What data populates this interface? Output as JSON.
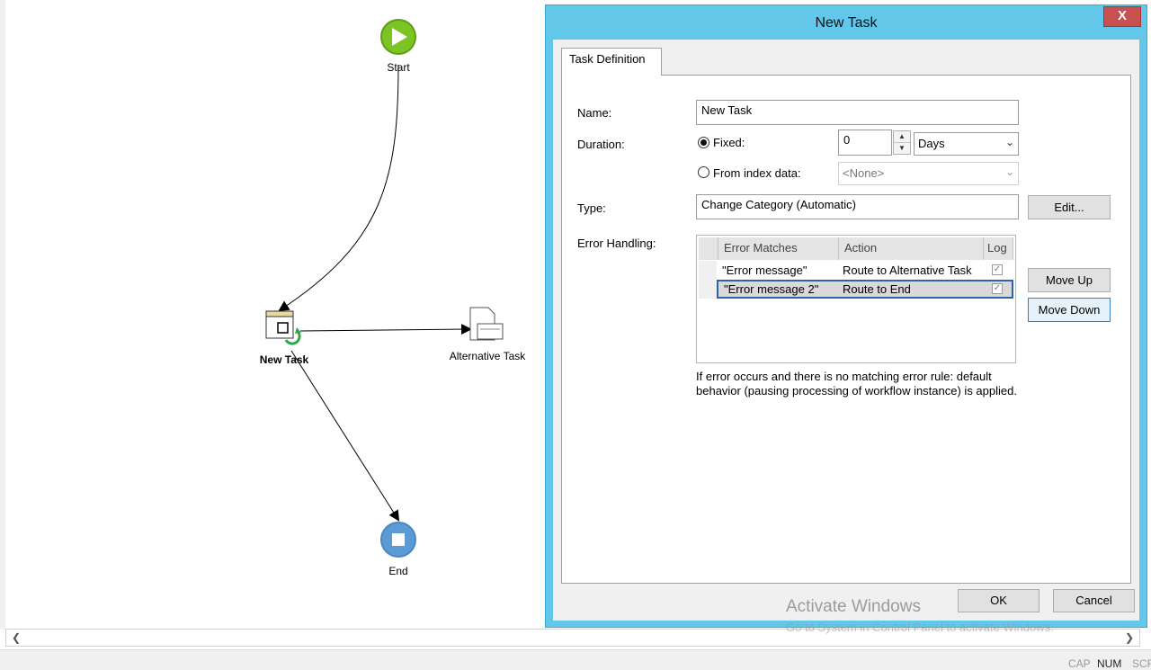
{
  "workflow": {
    "nodes": {
      "start": "Start",
      "new_task": "New Task",
      "alternative_task": "Alternative Task",
      "end": "End"
    }
  },
  "dialog": {
    "title": "New Task",
    "close_label": "X",
    "tab": "Task Definition",
    "name_label": "Name:",
    "name_value": "New Task",
    "duration_label": "Duration:",
    "fixed_label": "Fixed:",
    "fixed_value": "0",
    "unit_value": "Days",
    "from_index_label": "From index data:",
    "index_value": "<None>",
    "type_label": "Type:",
    "type_value": "Change Category (Automatic)",
    "edit_button": "Edit...",
    "error_handling_label": "Error Handling:",
    "error_table": {
      "headers": [
        "Error Matches",
        "Action",
        "Log"
      ],
      "rows": [
        {
          "match": "\"Error message\"",
          "action": "Route to Alternative Task",
          "log": true
        },
        {
          "match": "\"Error message 2\"",
          "action": "Route to End",
          "log": true
        }
      ]
    },
    "move_up_button": "Move Up",
    "move_down_button": "Move Down",
    "note": "If error occurs and there is no matching error rule: default behavior (pausing processing of workflow instance) is applied.",
    "ok_button": "OK",
    "cancel_button": "Cancel"
  },
  "watermark": {
    "title": "Activate Windows",
    "subtitle": "Go to System in Control Panel to activate Windows."
  },
  "statusbar": [
    "CAP",
    "NUM",
    "SCRL"
  ],
  "colors": {
    "start_node": "#7bc423",
    "end_node": "#5b9bd5",
    "dialog_frame": "#63c7e9",
    "close_button": "#c75050"
  }
}
